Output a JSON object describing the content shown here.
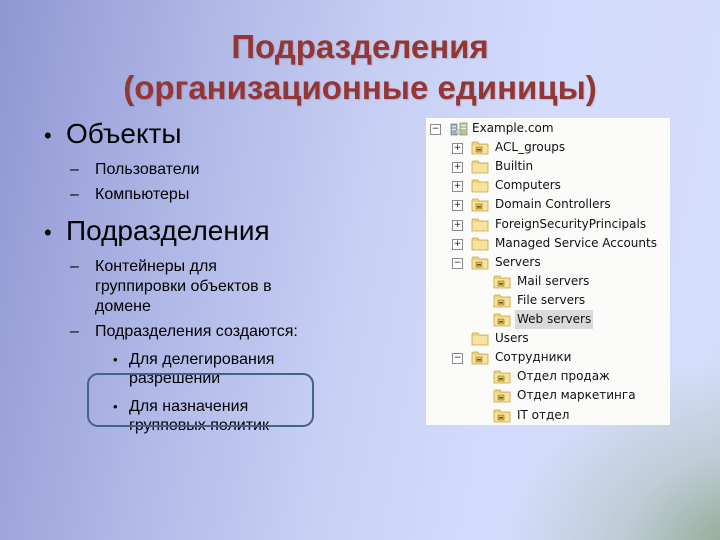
{
  "slide": {
    "title_line1": "Подразделения",
    "title_line2": "(организационные единицы)",
    "bullets": [
      {
        "text": "Объекты",
        "subitems": [
          {
            "text": "Пользователи"
          },
          {
            "text": "Компьютеры"
          }
        ]
      },
      {
        "text": "Подразделения",
        "subitems": [
          {
            "text_lines": [
              "Контейнеры для",
              "группировки объектов в",
              "домене"
            ]
          },
          {
            "text": "Подразделения создаются:",
            "subitems": [
              {
                "text_lines": [
                  "Для делегирования",
                  "разрешении"
                ]
              },
              {
                "text_lines": [
                  "Для назначения",
                  "групповых политик"
                ]
              }
            ]
          }
        ]
      }
    ],
    "bullet_glyph": "•",
    "dash_glyph": "–",
    "highlight_color": "#43638a",
    "title_color": "#963634"
  },
  "tree": {
    "expand_glyph": "+",
    "collapse_glyph": "−",
    "root": {
      "label": "Example.com",
      "icon": "domain-icon",
      "state": "expanded"
    },
    "nodes": [
      {
        "label": "ACL_groups",
        "icon": "ou-folder-icon",
        "state": "collapsed",
        "level": 1
      },
      {
        "label": "Builtin",
        "icon": "folder-icon",
        "state": "collapsed",
        "level": 1
      },
      {
        "label": "Computers",
        "icon": "folder-icon",
        "state": "collapsed",
        "level": 1
      },
      {
        "label": "Domain Controllers",
        "icon": "ou-folder-icon",
        "state": "collapsed",
        "level": 1
      },
      {
        "label": "ForeignSecurityPrincipals",
        "icon": "folder-icon",
        "state": "collapsed",
        "level": 1
      },
      {
        "label": "Managed Service Accounts",
        "icon": "folder-icon",
        "state": "collapsed",
        "level": 1
      },
      {
        "label": "Servers",
        "icon": "ou-folder-icon",
        "state": "expanded",
        "level": 1
      },
      {
        "label": "Mail servers",
        "icon": "ou-folder-icon",
        "state": "leaf",
        "level": 2
      },
      {
        "label": "File servers",
        "icon": "ou-folder-icon",
        "state": "leaf",
        "level": 2
      },
      {
        "label": "Web servers",
        "icon": "ou-folder-icon",
        "state": "leaf",
        "level": 2,
        "selected": true
      },
      {
        "label": "Users",
        "icon": "folder-icon",
        "state": "leaf",
        "level": 1
      },
      {
        "label": "Сотрудники",
        "icon": "ou-folder-icon",
        "state": "expanded",
        "level": 1
      },
      {
        "label": "Отдел продаж",
        "icon": "ou-folder-icon",
        "state": "leaf",
        "level": 2
      },
      {
        "label": "Отдел маркетинга",
        "icon": "ou-folder-icon",
        "state": "leaf",
        "level": 2
      },
      {
        "label": "IT отдел",
        "icon": "ou-folder-icon",
        "state": "leaf",
        "level": 2
      }
    ]
  }
}
